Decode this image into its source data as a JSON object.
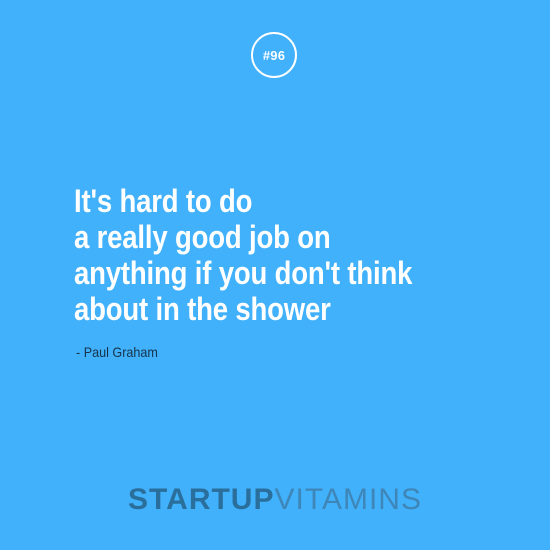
{
  "badge": {
    "text": "#96"
  },
  "quote": {
    "lines": [
      "It's hard to do",
      "a really good job on",
      "anything if you don't think",
      "about in the shower"
    ]
  },
  "author": "- Paul Graham",
  "brand": {
    "bold": "STARTUP",
    "light": "VITAMINS"
  },
  "colors": {
    "background": "#41b1fb",
    "text_primary": "#ffffff",
    "author_text": "#16334b",
    "brand_bold": "#2a6f9c",
    "brand_light": "#3e86b8"
  }
}
